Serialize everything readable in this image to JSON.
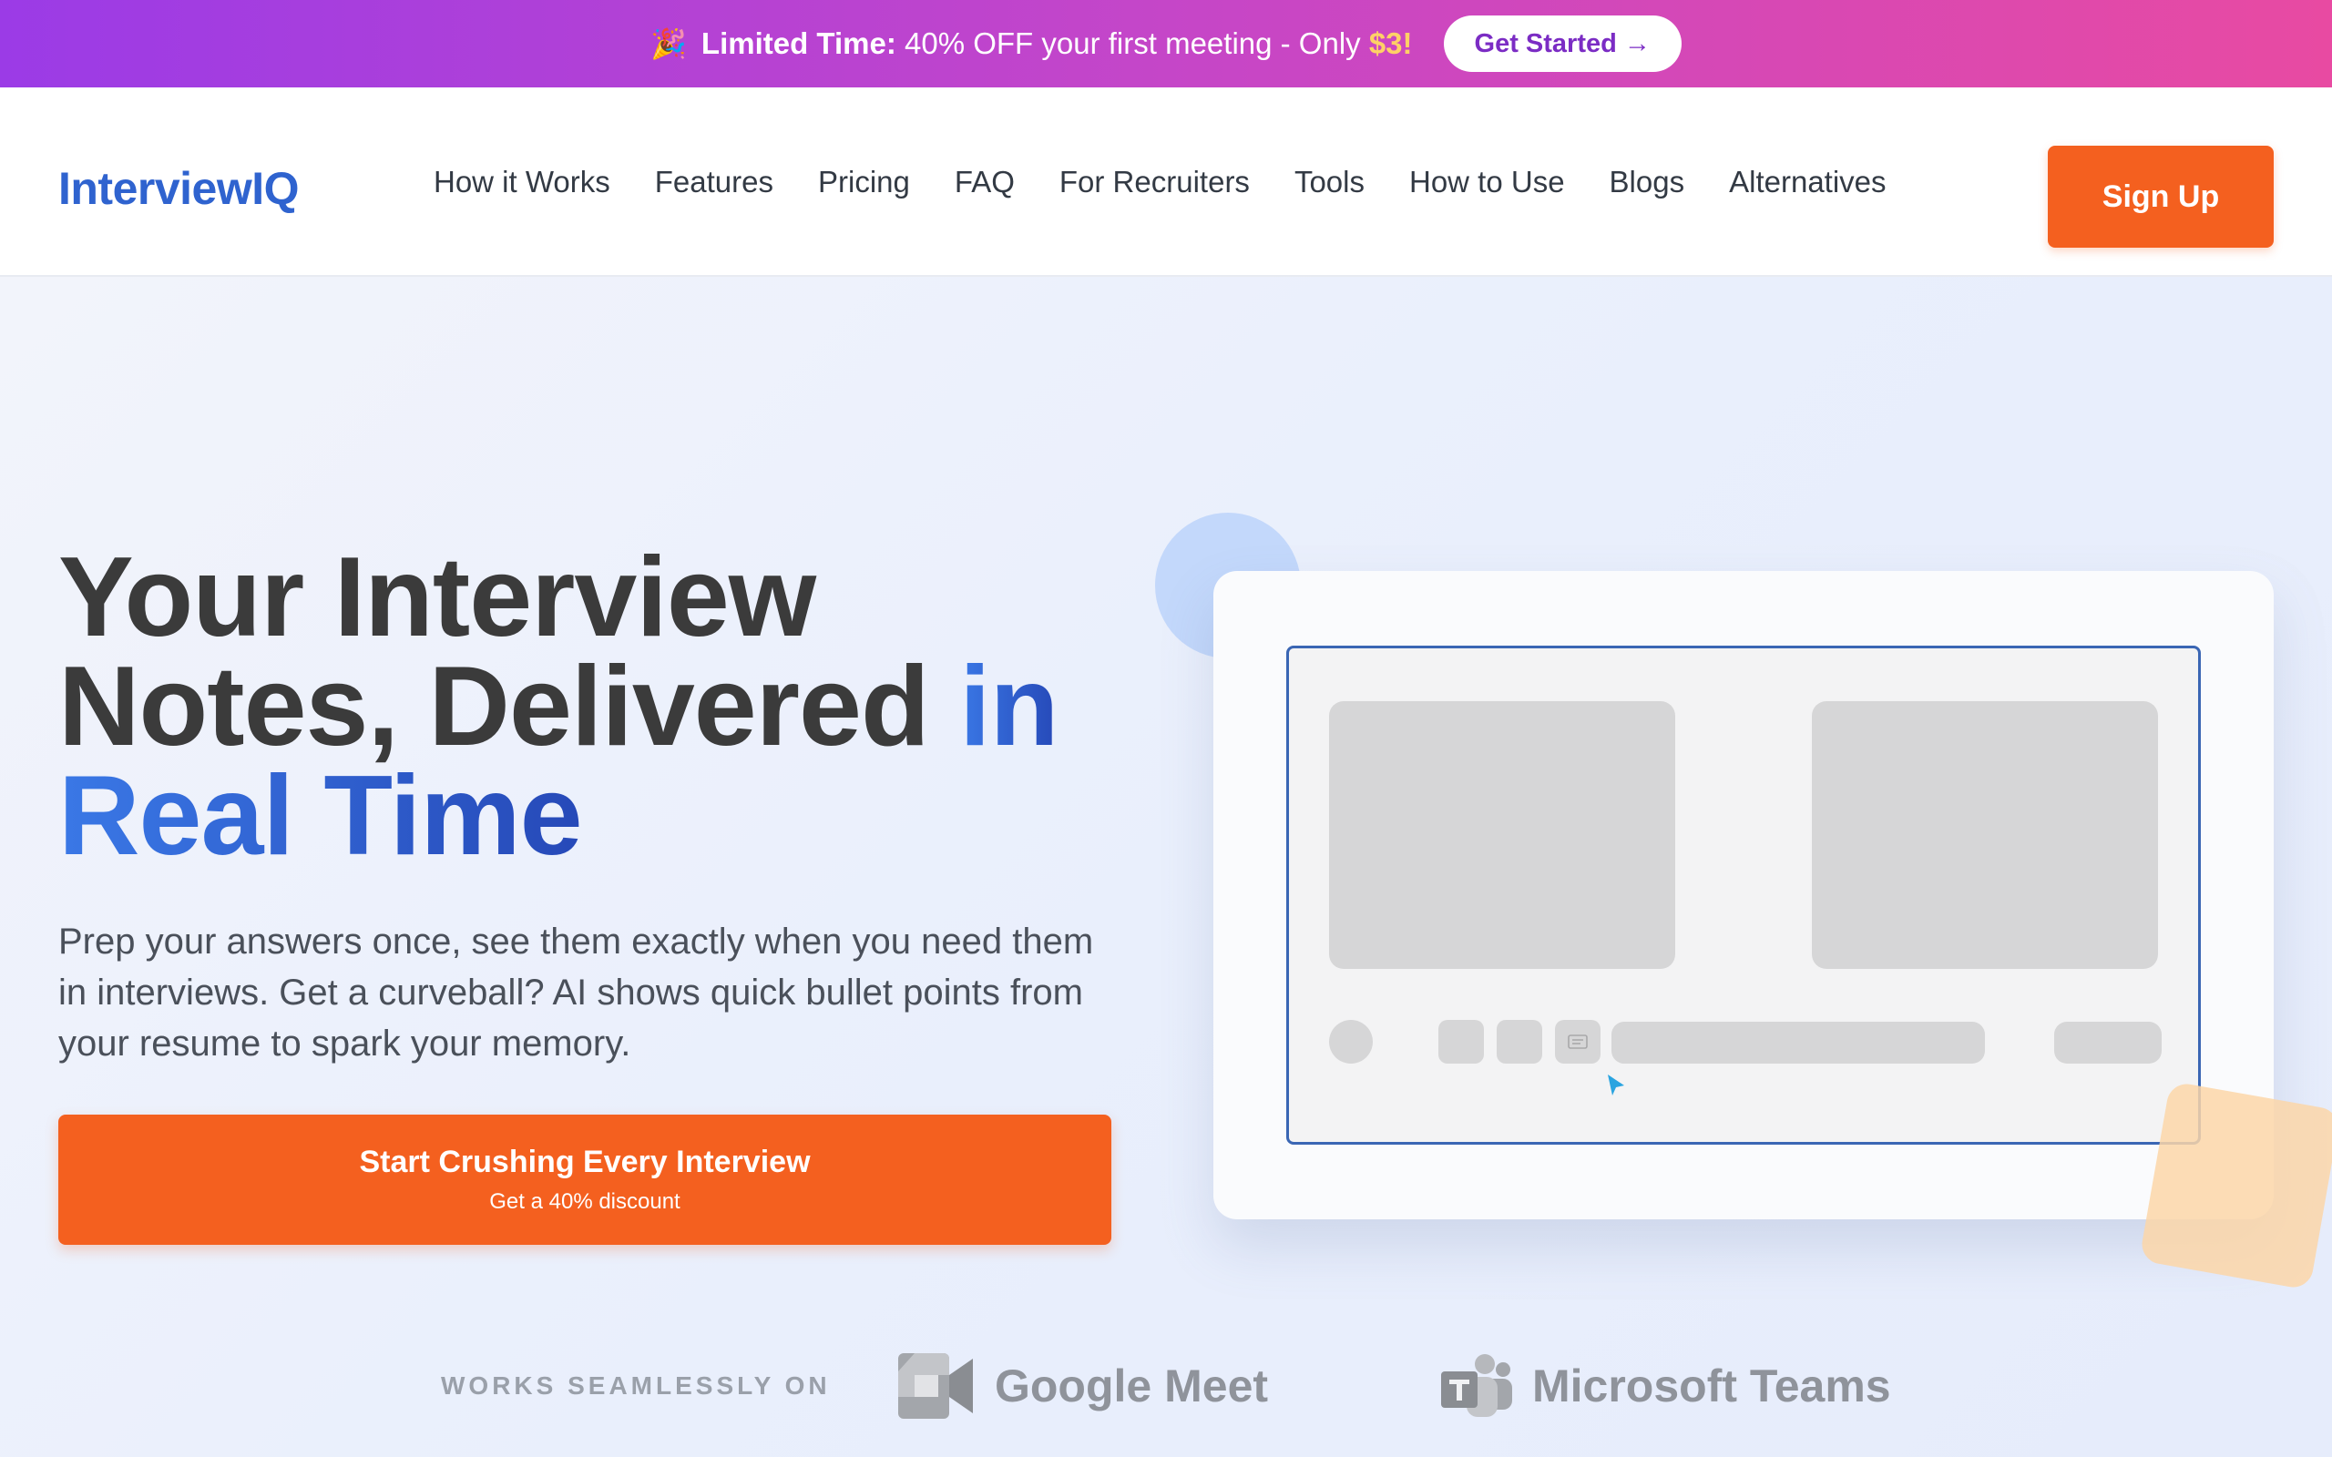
{
  "promo": {
    "emoji": "🎉",
    "lead": "Limited Time:",
    "text": "40% OFF your first meeting - Only",
    "price": "$3!",
    "button_label": "Get Started →"
  },
  "nav": {
    "logo": "InterviewIQ",
    "links": [
      {
        "label": "How it Works"
      },
      {
        "label": "Features"
      },
      {
        "label": "Pricing"
      },
      {
        "label": "FAQ"
      },
      {
        "label": "For Recruiters"
      },
      {
        "label": "Tools"
      },
      {
        "label": "How to Use"
      },
      {
        "label": "Blogs"
      },
      {
        "label": "Alternatives"
      }
    ],
    "signup_label": "Sign Up"
  },
  "hero": {
    "title_line1": "Your Interview",
    "title_line2": "Notes, Delivered",
    "title_accent_1": "in",
    "title_accent_2": "Real Time",
    "subtitle": "Prep your answers once, see them exactly when you need them in interviews. Get a curveball? AI shows quick bullet points from your resume to spark your memory.",
    "cta_title": "Start Crushing Every Interview",
    "cta_sub": "Get a 40% discount"
  },
  "works_on": {
    "label": "WORKS SEAMLESSLY ON",
    "platforms": [
      {
        "name": "Google Meet",
        "icon": "google-meet-icon"
      },
      {
        "name": "Microsoft Teams",
        "icon": "microsoft-teams-icon"
      }
    ]
  },
  "colors": {
    "accent_orange": "#f4601f",
    "brand_blue": "#2f63cf",
    "promo_start": "#9b3be6",
    "promo_end": "#e84aa2"
  }
}
